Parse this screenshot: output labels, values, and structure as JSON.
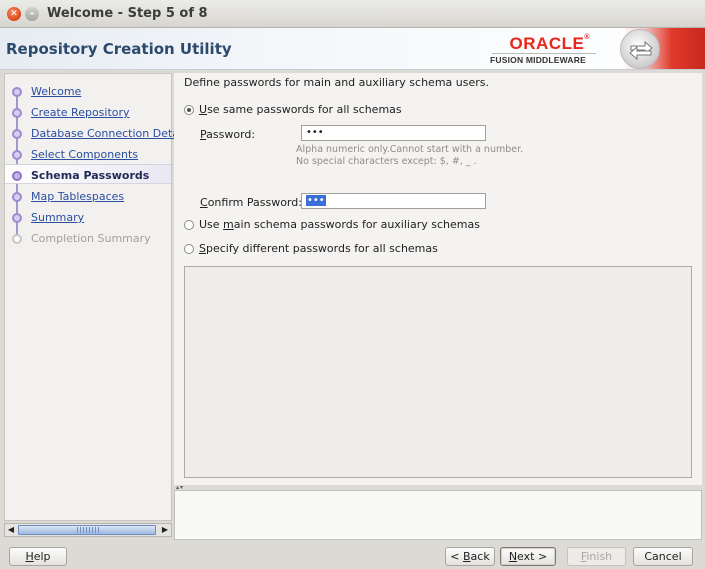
{
  "window": {
    "title": "Welcome - Step 5 of 8"
  },
  "header": {
    "title": "Repository Creation Utility",
    "logo_oracle": "ORACLE",
    "logo_tm": "®",
    "logo_subtitle": "FUSION MIDDLEWARE"
  },
  "nav": {
    "items": [
      {
        "label": "Welcome",
        "state": "done"
      },
      {
        "label": "Create Repository",
        "state": "done"
      },
      {
        "label": "Database Connection Details",
        "state": "done"
      },
      {
        "label": "Select Components",
        "state": "done"
      },
      {
        "label": "Schema Passwords",
        "state": "active"
      },
      {
        "label": "Map Tablespaces",
        "state": "link"
      },
      {
        "label": "Summary",
        "state": "link"
      },
      {
        "label": "Completion Summary",
        "state": "pending"
      }
    ]
  },
  "main": {
    "intro": "Define passwords for main and auxiliary schema users.",
    "option_same": {
      "pre": "",
      "mnemonic": "U",
      "post": "se same passwords for all schemas",
      "selected": true
    },
    "password_label": {
      "pre": "",
      "mnemonic": "P",
      "post": "assword:"
    },
    "password_value": "•••",
    "hint_line1": "Alpha numeric only.Cannot start with a number.",
    "hint_line2": "No special characters except: $, #, _ .",
    "confirm_label": {
      "pre": "",
      "mnemonic": "C",
      "post": "onfirm Password:"
    },
    "confirm_value": "•••",
    "option_main": {
      "pre": "Use ",
      "mnemonic": "m",
      "post": "ain schema passwords for auxiliary schemas",
      "selected": false
    },
    "option_specify": {
      "pre": "",
      "mnemonic": "S",
      "post": "pecify different passwords for all schemas",
      "selected": false
    }
  },
  "buttons": {
    "help": {
      "pre": "",
      "mnemonic": "H",
      "post": "elp"
    },
    "back": {
      "pre": "< ",
      "mnemonic": "B",
      "post": "ack"
    },
    "next": {
      "pre": "",
      "mnemonic": "N",
      "post": "ext >"
    },
    "finish": {
      "pre": "",
      "mnemonic": "F",
      "post": "inish"
    },
    "cancel": "Cancel"
  },
  "colors": {
    "accent_red": "#e8261a",
    "header_blue": "#2c4a6e",
    "nav_link": "#2a4ea0",
    "selection": "#3a6fd8"
  },
  "icons": {
    "window_close": "close-icon",
    "window_minimize": "minimize-icon",
    "banner_badge": "arrows-exchange-icon"
  }
}
